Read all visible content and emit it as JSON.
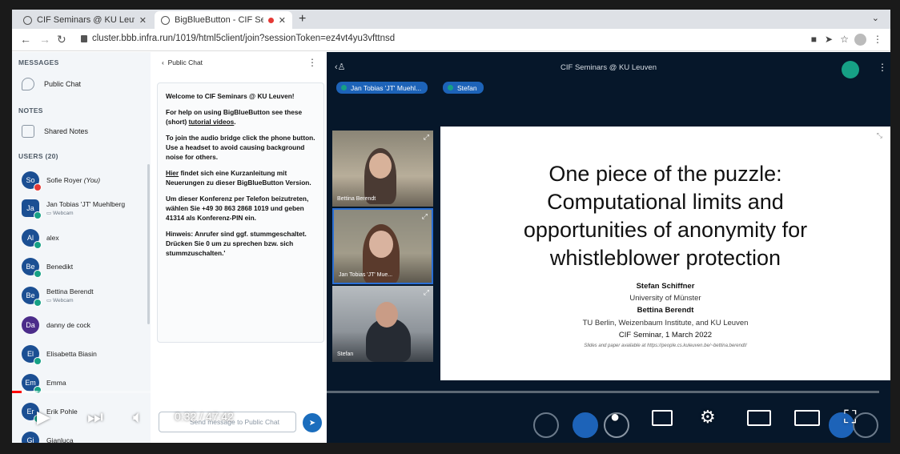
{
  "browser": {
    "tabs": [
      {
        "title": "CIF Seminars @ KU Leuven",
        "active": false
      },
      {
        "title": "BigBlueButton - CIF Se",
        "active": true
      }
    ],
    "url": "cluster.bbb.infra.run/1019/html5client/join?sessionToken=ez4vt4yu3vfttnsd"
  },
  "sidebar": {
    "messages_heading": "MESSAGES",
    "public_chat": "Public Chat",
    "notes_heading": "NOTES",
    "shared_notes": "Shared Notes",
    "users_heading": "USERS (20)",
    "users": [
      {
        "initials": "So",
        "name": "Sofie Royer",
        "sub": "(You)",
        "mic": "muted"
      },
      {
        "initials": "Ja",
        "name": "Jan Tobias 'JT' Muehlberg",
        "sub": "Webcam",
        "mic": "on"
      },
      {
        "initials": "Al",
        "name": "alex",
        "sub": "",
        "mic": "on"
      },
      {
        "initials": "Be",
        "name": "Benedikt",
        "sub": "",
        "mic": "on"
      },
      {
        "initials": "Be",
        "name": "Bettina Berendt",
        "sub": "Webcam",
        "mic": "on"
      },
      {
        "initials": "Da",
        "name": "danny de cock",
        "sub": "",
        "mic": "none"
      },
      {
        "initials": "El",
        "name": "Elisabetta Biasin",
        "sub": "",
        "mic": "on"
      },
      {
        "initials": "Em",
        "name": "Emma",
        "sub": "",
        "mic": "on"
      },
      {
        "initials": "Er",
        "name": "Erik Pohle",
        "sub": "",
        "mic": "on"
      },
      {
        "initials": "Gi",
        "name": "Gianluca",
        "sub": "",
        "mic": "none"
      }
    ]
  },
  "chat": {
    "header": "Public Chat",
    "welcome_1_prefix": "Welcome to ",
    "welcome_1_bold": "CIF Seminars @ KU Leuven",
    "welcome_1_suffix": "!",
    "welcome_2_prefix": "For help on using BigBlueButton see these (short) ",
    "welcome_2_link": "tutorial videos",
    "welcome_2_suffix": ".",
    "welcome_3": "To join the audio bridge click the phone button. Use a headset to avoid causing background noise for others.",
    "welcome_4_link": "Hier",
    "welcome_4_rest": " findet sich eine Kurzanleitung mit Neuerungen zu dieser BigBlueButton Version.",
    "welcome_5": "Um dieser Konferenz per Telefon beizutreten, wählen Sie +49 30 863 2868 1019 und geben 41314 als Konferenz-PIN ein.",
    "welcome_6_bold": "Hinweis:",
    "welcome_6_rest": " Anrufer sind ggf. stummgeschaltet. Drücken Sie 0 um zu sprechen bzw. sich stummzuschalten.'",
    "input_placeholder": "Send message to Public Chat"
  },
  "meeting": {
    "title": "CIF Seminars @ KU Leuven",
    "talkers": [
      "Jan Tobias 'JT' Muehl...",
      "Stefan"
    ],
    "videos": [
      {
        "name": "Bettina Berendt"
      },
      {
        "name": "Jan Tobias 'JT' Mue..."
      },
      {
        "name": "Stefan"
      }
    ]
  },
  "slide": {
    "title_lines": [
      "One piece of the puzzle:",
      "Computational limits and",
      "opportunities of anonymity for",
      "whistleblower protection"
    ],
    "author_1": "Stefan Schiffner",
    "affil_1": "University of Münster",
    "author_2": "Bettina Berendt",
    "affil_2": "TU Berlin, Weizenbaum Institute, and KU Leuven",
    "event": "CIF Seminar, 1 March 2022",
    "note": "Slides and paper available at https://people.cs.kuleuven.be/~bettina.berendt/"
  },
  "player": {
    "timecode": "0:32 / 47:42",
    "progress_played": 0.011,
    "progress_buffered": 0.03
  },
  "colors": {
    "accent": "#1d63b8",
    "meeting_bg": "#06172a",
    "progress": "#ff0000"
  }
}
